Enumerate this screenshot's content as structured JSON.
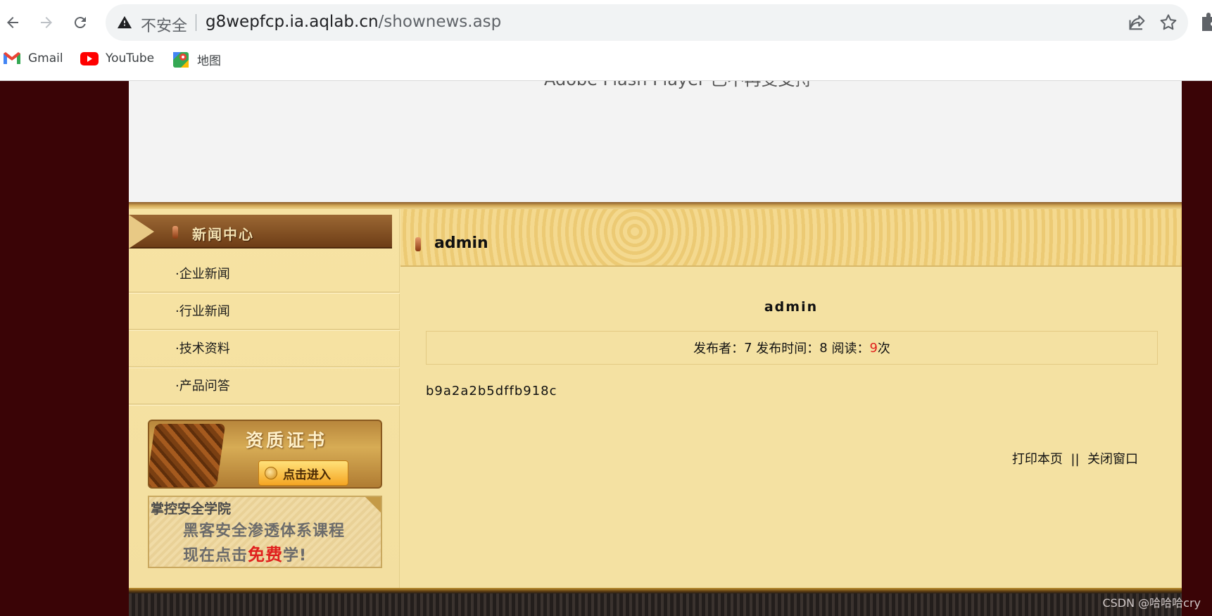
{
  "browser": {
    "omnibox": {
      "insecure_label": "不安全",
      "url_host": "g8wepfcp.ia.aqlab.cn",
      "url_path": "/shownews.asp"
    },
    "bookmarks": [
      {
        "label": "Gmail",
        "icon": "gmail-icon"
      },
      {
        "label": "YouTube",
        "icon": "youtube-icon"
      },
      {
        "label": "地图",
        "icon": "maps-icon"
      }
    ]
  },
  "page": {
    "flash_notice": "Adobe Flash Player 已不再受支持",
    "sidebar": {
      "title": "新闻中心",
      "items": [
        {
          "label": "·企业新闻"
        },
        {
          "label": "·行业新闻"
        },
        {
          "label": "·技术资料"
        },
        {
          "label": "·产品问答"
        }
      ],
      "cert_banner": {
        "title": "资质证书",
        "button": "点击进入"
      },
      "academy_banner": {
        "brand": "掌控安全学院",
        "line1": "黑客安全渗透体系课程",
        "line2_prefix": "现在点击",
        "line2_free": "免费",
        "line2_suffix": "学!"
      }
    },
    "article": {
      "section_title": "admin",
      "title": "admin",
      "meta": {
        "publisher_label": "发布者：",
        "publisher": "7",
        "time_label": "发布时间：",
        "time": "8",
        "reads_label": "阅读：",
        "reads": "9",
        "reads_unit": "次"
      },
      "body": "b9a2a2b5dffb918c",
      "print_link": "打印本页",
      "separator": "||",
      "close_link": "关闭窗口"
    },
    "watermark": "CSDN @哈哈哈cry"
  },
  "colors": {
    "page_background": "#3a0406",
    "content_background": "#f4e1a2",
    "read_count": "#e0201e"
  }
}
